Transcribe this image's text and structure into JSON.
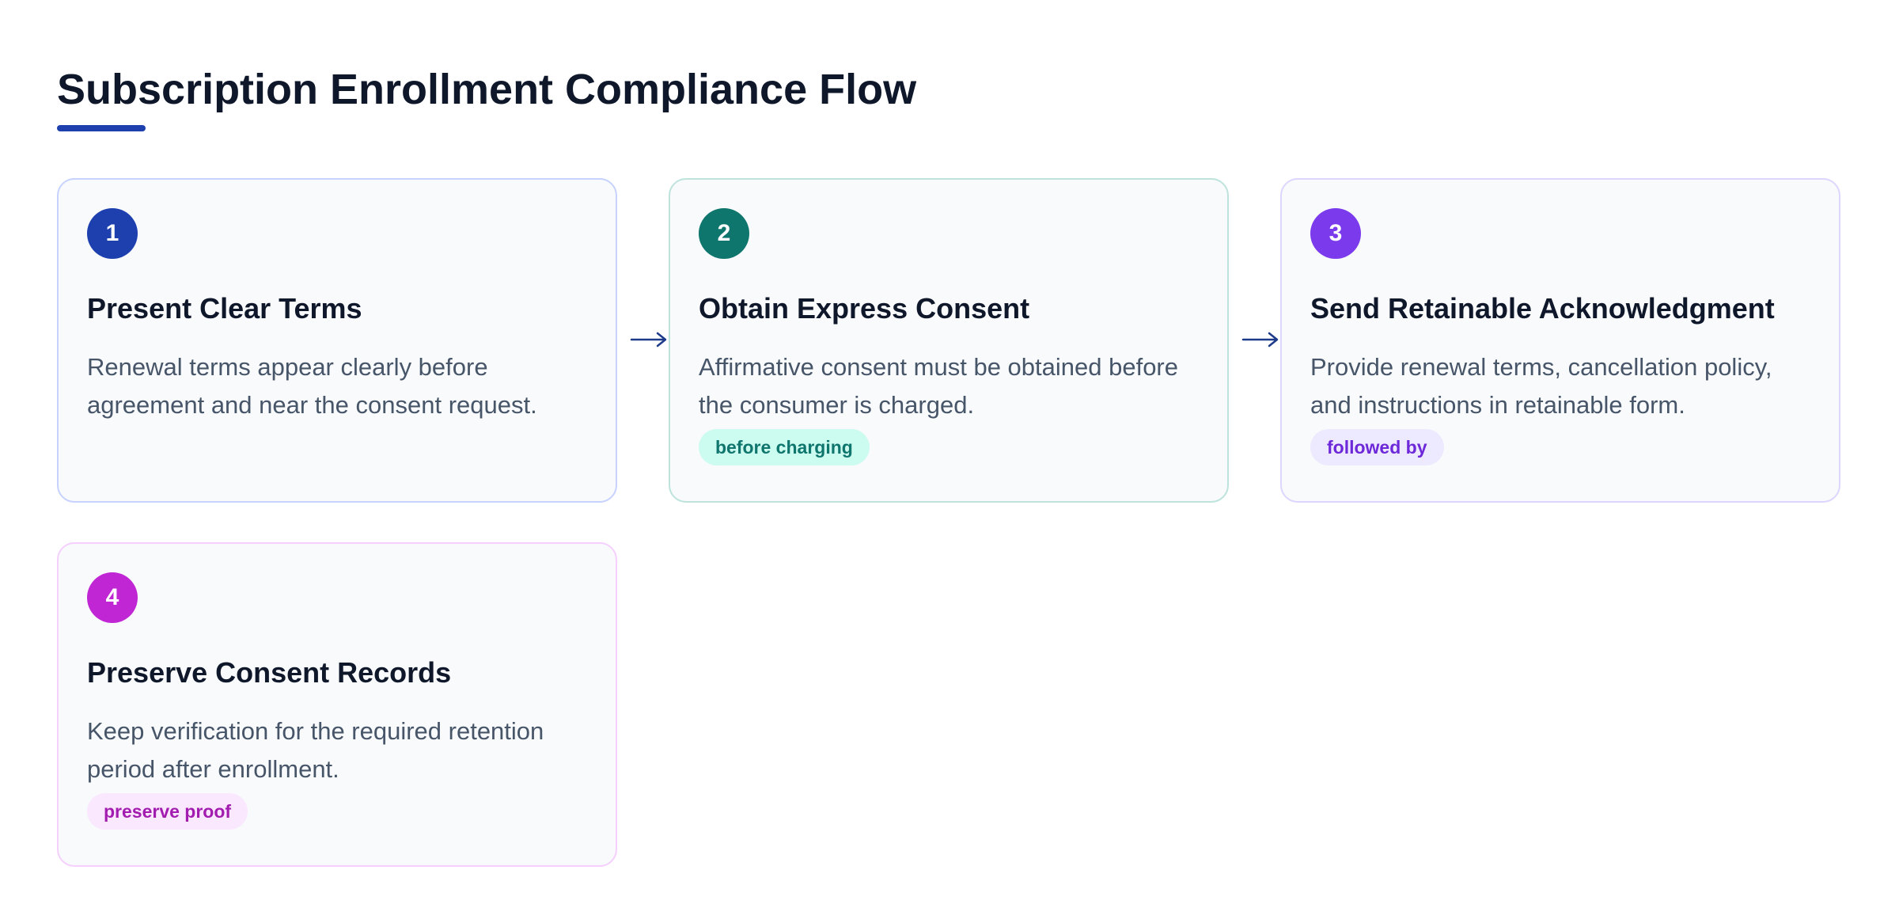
{
  "page": {
    "title": "Subscription Enrollment Compliance Flow"
  },
  "colors": {
    "accent": "#1e40af",
    "step1": "#1e40af",
    "step2": "#0f766e",
    "step3": "#7c3aed",
    "step4": "#c026d3"
  },
  "steps": [
    {
      "number": "1",
      "title": "Present Clear Terms",
      "description": "Renewal terms appear clearly before agreement and near the consent request.",
      "tag": ""
    },
    {
      "number": "2",
      "title": "Obtain Express Consent",
      "description": "Affirmative consent must be obtained before the consumer is charged.",
      "tag": "before charging"
    },
    {
      "number": "3",
      "title": "Send Retainable Acknowledgment",
      "description": "Provide renewal terms, cancellation policy, and instructions in retainable form.",
      "tag": "followed by"
    },
    {
      "number": "4",
      "title": "Preserve Consent Records",
      "description": "Keep verification for the required retention period after enrollment.",
      "tag": "preserve proof"
    }
  ],
  "connectors": [
    {
      "from": "1",
      "to": "2",
      "icon": "arrow-right-icon"
    },
    {
      "from": "2",
      "to": "3",
      "icon": "arrow-right-icon"
    }
  ]
}
